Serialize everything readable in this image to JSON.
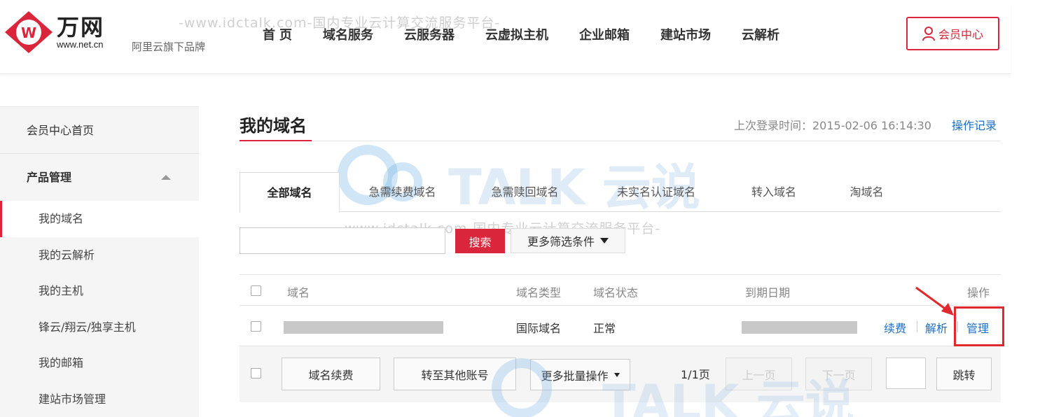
{
  "header": {
    "watermark": "-www.idctalk.com-国内专业云计算交流服务平台-",
    "logo_name": "万网",
    "logo_url": "www.net.cn",
    "slogan": "阿里云旗下品牌",
    "nav": [
      "首页",
      "域名服务",
      "云服务器",
      "云虚拟主机",
      "企业邮箱",
      "建站市场",
      "云解析"
    ],
    "member_center": "会员中心"
  },
  "sidebar": {
    "home": "会员中心首页",
    "group": "产品管理",
    "items": [
      "我的域名",
      "我的云解析",
      "我的主机",
      "锋云/翔云/独享主机",
      "我的邮箱",
      "建站市场管理"
    ]
  },
  "main": {
    "title": "我的域名",
    "last_login_label": "上次登录时间：2015-02-06 16:14:30",
    "op_log": "操作记录",
    "tabs": [
      "全部域名",
      "急需续费域名",
      "急需赎回域名",
      "未实名认证域名",
      "转入域名",
      "淘域名"
    ],
    "search_button": "搜索",
    "filter_button": "更多筛选条件",
    "table": {
      "headers": [
        "域名",
        "域名类型",
        "域名状态",
        "到期日期",
        "操作"
      ],
      "row": {
        "type": "国际域名",
        "status": "正常",
        "actions": [
          "续费",
          "解析",
          "管理"
        ]
      }
    },
    "bottom": {
      "renew": "域名续费",
      "transfer": "转至其他账号",
      "batch": "更多批量操作",
      "page_count": "1/1页",
      "prev": "上一页",
      "next": "下一页",
      "jump": "跳转"
    },
    "watermark_mid": "-www.idctalk.com-国内专业云计算交流服务平台-",
    "watermark_logo": "TALK 云说"
  },
  "colors": {
    "accent": "#d9263a",
    "link": "#1a6fc4"
  }
}
